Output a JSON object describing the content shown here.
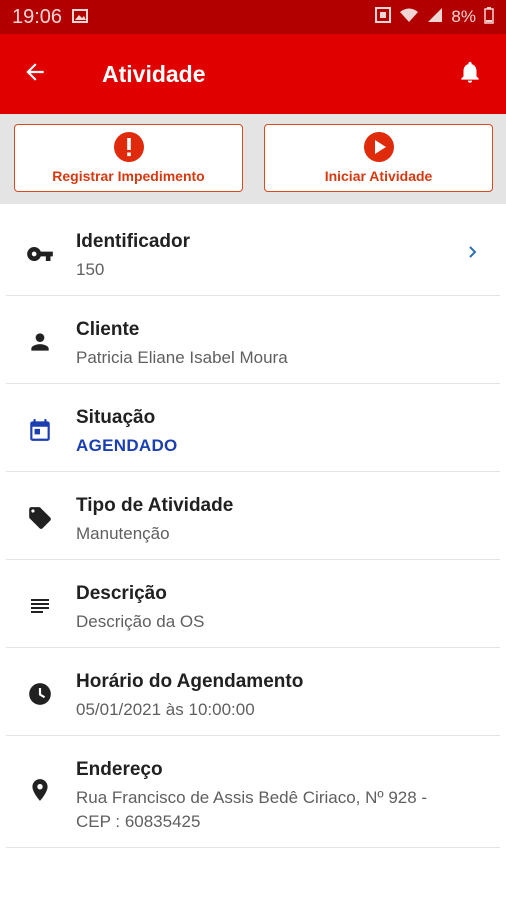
{
  "status_bar": {
    "time": "19:06",
    "battery": "8%"
  },
  "app_bar": {
    "title": "Atividade"
  },
  "actions": {
    "register_label": "Registrar Impedimento",
    "start_label": "Iniciar Atividade"
  },
  "details": [
    {
      "label": "Identificador",
      "value": "150",
      "icon": "key-icon"
    },
    {
      "label": "Cliente",
      "value": "Patricia Eliane Isabel Moura",
      "icon": "person-icon"
    },
    {
      "label": "Situação",
      "value": "AGENDADO",
      "icon": "calendar-icon"
    },
    {
      "label": "Tipo de Atividade",
      "value": "Manutenção",
      "icon": "tag-icon"
    },
    {
      "label": "Descrição",
      "value": "Descrição da OS",
      "icon": "notes-icon"
    },
    {
      "label": "Horário do Agendamento",
      "value": "05/01/2021 às 10:00:00",
      "icon": "clock-icon"
    },
    {
      "label": "Endereço",
      "value": "Rua Francisco de Assis Bedê Ciriaco, Nº 928 - CEP : 60835425",
      "icon": "location-pin-icon"
    }
  ],
  "colors": {
    "primary": "#e00000",
    "status_bar": "#b20000",
    "accent_orange": "#e02a0c",
    "status_blue": "#1b3fb0"
  }
}
